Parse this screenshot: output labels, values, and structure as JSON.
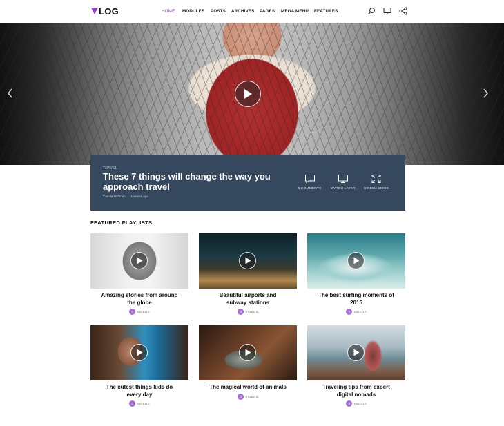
{
  "header": {
    "logo_text": "LOG",
    "nav": {
      "home": "HOME",
      "modules": "MODULES",
      "posts": "POSTS",
      "archives": "ARCHIVES",
      "pages": "PAGES",
      "mega_menu": "MEGA MENU",
      "features": "FEATURES"
    },
    "icons": [
      "search-icon",
      "monitor-icon",
      "share-icon"
    ]
  },
  "hero": {
    "icons": [
      "chevron-left-icon",
      "play-icon",
      "chevron-right-icon"
    ]
  },
  "feature": {
    "category": "TRAVEL",
    "title": "These 7 things will change the way you approach travel",
    "author": "Camila Hoffman",
    "separator": "/",
    "time": "4 weeks ago",
    "actions": {
      "comments": "3 COMMENTS",
      "watch_later": "WATCH LATER",
      "cinema_mode": "CINEMA MODE"
    }
  },
  "playlists": {
    "heading": "FEATURED PLAYLISTS",
    "count_label": "VIDEOS",
    "items": [
      {
        "title": "Amazing stories from around the globe",
        "count": "4"
      },
      {
        "title": "Beautiful airports and subway stations",
        "count": "4"
      },
      {
        "title": "The best surfing moments of 2015",
        "count": "5"
      },
      {
        "title": "The cutest things kids do every day",
        "count": "3"
      },
      {
        "title": "The magical world of animals",
        "count": "3"
      },
      {
        "title": "Traveling tips from expert digital nomads",
        "count": "5"
      }
    ]
  },
  "colors": {
    "accent": "#8e3fc9",
    "feature_bg": "#36485e",
    "badge": "#a86bd6"
  }
}
